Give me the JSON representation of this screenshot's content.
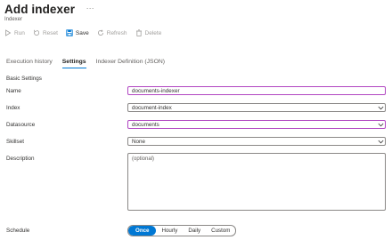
{
  "header": {
    "title": "Add indexer",
    "subtitle": "Indexer",
    "more": "···"
  },
  "toolbar": {
    "run": "Run",
    "reset": "Reset",
    "save": "Save",
    "refresh": "Refresh",
    "delete": "Delete"
  },
  "tabs": [
    {
      "label": "Execution history",
      "active": false
    },
    {
      "label": "Settings",
      "active": true
    },
    {
      "label": "Indexer Definition (JSON)",
      "active": false
    }
  ],
  "form": {
    "section": "Basic Settings",
    "name": {
      "label": "Name",
      "value": "documents-indexer"
    },
    "index": {
      "label": "Index",
      "value": "document-index"
    },
    "datasource": {
      "label": "Datasource",
      "value": "documents"
    },
    "skillset": {
      "label": "Skillset",
      "value": "None"
    },
    "description": {
      "label": "Description",
      "placeholder": "(optional)"
    },
    "schedule": {
      "label": "Schedule",
      "options": [
        "Once",
        "Hourly",
        "Daily",
        "Custom"
      ],
      "selected": "Once"
    }
  },
  "colors": {
    "accent": "#0078d4",
    "focus_border": "#b146c2"
  }
}
